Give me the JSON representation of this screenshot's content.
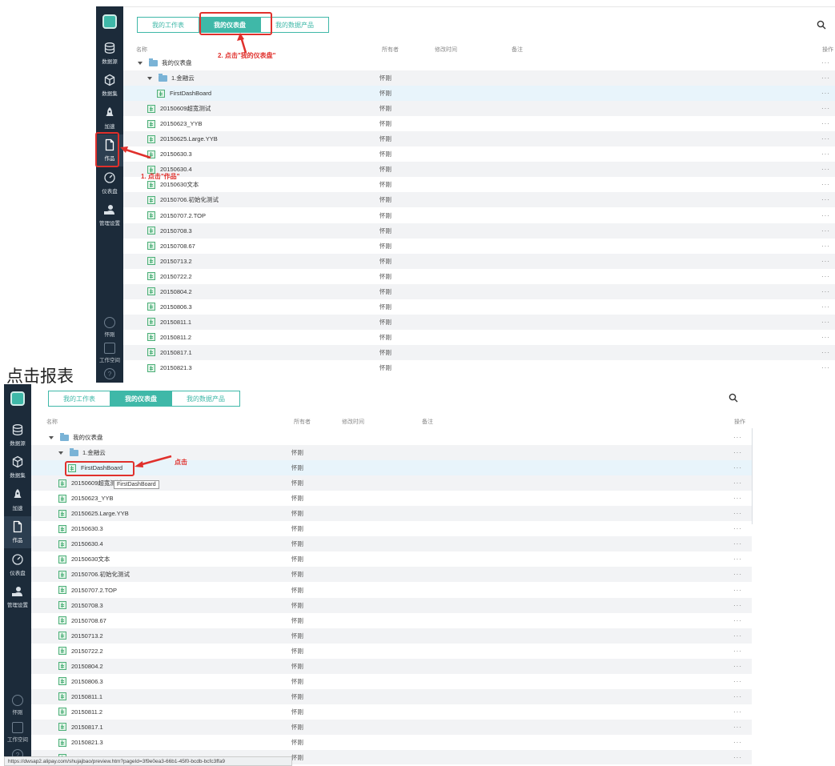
{
  "caption_mid": "点击报表",
  "top": {
    "tabs": [
      "我的工作表",
      "我的仪表盘",
      "我的数据产品"
    ],
    "active_tab": 1,
    "headers": {
      "name": "名称",
      "owner": "所有者",
      "modified": "修改时间",
      "note": "备注",
      "ops": "操作"
    },
    "sidebar": [
      {
        "label": "数据源",
        "icon": "database-icon"
      },
      {
        "label": "数据集",
        "icon": "cube-icon"
      },
      {
        "label": "加速",
        "icon": "rocket-icon"
      },
      {
        "label": "作品",
        "icon": "document-icon"
      },
      {
        "label": "仪表盘",
        "icon": "gauge-icon"
      },
      {
        "label": "管理设置",
        "icon": "admin-user-icon"
      }
    ],
    "sidebar_bottom": [
      {
        "label": "怀刚",
        "icon": "user-circle-icon"
      },
      {
        "label": "工作空间",
        "icon": "workspace-icon"
      },
      {
        "label": "",
        "icon": "help-icon"
      }
    ],
    "annotation_step1": "1. 点击\"作品\"",
    "annotation_step2": "2. 点击\"我的仪表盘\""
  },
  "bottom": {
    "tabs": [
      "我的工作表",
      "我的仪表盘",
      "我的数据产品"
    ],
    "active_tab": 1,
    "headers": {
      "name": "名称",
      "owner": "所有者",
      "modified": "修改时间",
      "note": "备注",
      "ops": "操作"
    },
    "sidebar": [
      {
        "label": "数据源",
        "icon": "database-icon"
      },
      {
        "label": "数据集",
        "icon": "cube-icon"
      },
      {
        "label": "加速",
        "icon": "rocket-icon"
      },
      {
        "label": "作品",
        "icon": "document-icon"
      },
      {
        "label": "仪表盘",
        "icon": "gauge-icon"
      },
      {
        "label": "管理设置",
        "icon": "admin-user-icon"
      }
    ],
    "sidebar_bottom": [
      {
        "label": "怀刚",
        "icon": "user-circle-icon"
      },
      {
        "label": "工作空间",
        "icon": "workspace-icon"
      },
      {
        "label": "",
        "icon": "help-icon"
      }
    ],
    "annotation": "点击",
    "tooltip": "FirstDashBoard",
    "status_url": "https://dwsap2.alipay.com/shujajbao/preview.htm?pageId=3f9e0ea3-66b1-45f0-bcdb-bcfc3ffa9"
  },
  "rows": [
    {
      "name": "我的仪表盘",
      "owner": "",
      "level": 0,
      "kind": "folder",
      "expanded": true
    },
    {
      "name": "1.金融云",
      "owner": "怀刚",
      "level": 1,
      "kind": "folder",
      "expanded": true
    },
    {
      "name": "FirstDashBoard",
      "owner": "怀刚",
      "level": 2,
      "kind": "dashboard",
      "selected": true
    },
    {
      "name": "20150609超宽测试",
      "owner": "怀刚",
      "level": 1,
      "kind": "dashboard"
    },
    {
      "name": "20150623_YYB",
      "owner": "怀刚",
      "level": 1,
      "kind": "dashboard"
    },
    {
      "name": "20150625.Large.YYB",
      "owner": "怀刚",
      "level": 1,
      "kind": "dashboard"
    },
    {
      "name": "20150630.3",
      "owner": "怀刚",
      "level": 1,
      "kind": "dashboard"
    },
    {
      "name": "20150630.4",
      "owner": "怀刚",
      "level": 1,
      "kind": "dashboard"
    },
    {
      "name": "20150630文本",
      "owner": "怀刚",
      "level": 1,
      "kind": "dashboard"
    },
    {
      "name": "20150706.初始化测试",
      "owner": "怀刚",
      "level": 1,
      "kind": "dashboard"
    },
    {
      "name": "20150707.2.TOP",
      "owner": "怀刚",
      "level": 1,
      "kind": "dashboard"
    },
    {
      "name": "20150708.3",
      "owner": "怀刚",
      "level": 1,
      "kind": "dashboard"
    },
    {
      "name": "20150708.67",
      "owner": "怀刚",
      "level": 1,
      "kind": "dashboard"
    },
    {
      "name": "20150713.2",
      "owner": "怀刚",
      "level": 1,
      "kind": "dashboard"
    },
    {
      "name": "20150722.2",
      "owner": "怀刚",
      "level": 1,
      "kind": "dashboard"
    },
    {
      "name": "20150804.2",
      "owner": "怀刚",
      "level": 1,
      "kind": "dashboard"
    },
    {
      "name": "20150806.3",
      "owner": "怀刚",
      "level": 1,
      "kind": "dashboard"
    },
    {
      "name": "20150811.1",
      "owner": "怀刚",
      "level": 1,
      "kind": "dashboard"
    },
    {
      "name": "20150811.2",
      "owner": "怀刚",
      "level": 1,
      "kind": "dashboard"
    },
    {
      "name": "20150817.1",
      "owner": "怀刚",
      "level": 1,
      "kind": "dashboard"
    },
    {
      "name": "20150821.3",
      "owner": "怀刚",
      "level": 1,
      "kind": "dashboard"
    },
    {
      "name": "",
      "owner": "怀刚",
      "level": 1,
      "kind": "dashboard"
    }
  ],
  "ops_glyph": "···",
  "colors": {
    "sidebar": "#1c2b3a",
    "accent": "#3fb8a8",
    "annotation": "#e0302c",
    "selected_row": "#e8f4fb",
    "odd_row": "#f2f3f5"
  }
}
